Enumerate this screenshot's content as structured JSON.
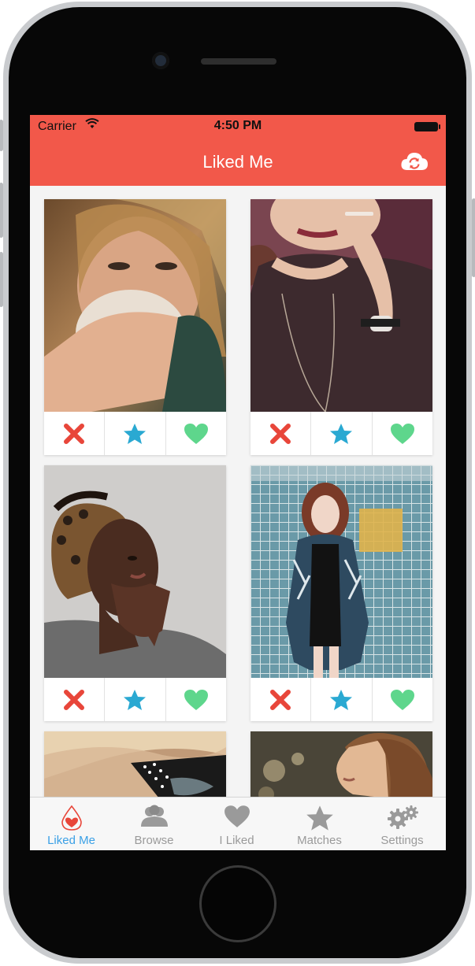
{
  "status": {
    "carrier": "Carrier",
    "time": "4:50 PM"
  },
  "navbar": {
    "title": "Liked Me",
    "sync_icon": "cloud-sync-icon"
  },
  "colors": {
    "brand": "#f2584a",
    "reject": "#e8463a",
    "star": "#2aa9d2",
    "like": "#5ed68c",
    "tab_active": "#3aa0e6",
    "tab_inactive": "#9a9a9a"
  },
  "cards": [
    {
      "photo": "woman-drinking-coffee"
    },
    {
      "photo": "woman-smoking-cigarette"
    },
    {
      "photo": "woman-looking-up"
    },
    {
      "photo": "woman-in-front-of-grid-wall"
    },
    {
      "photo": "woman-with-polka-dot-glasses"
    },
    {
      "photo": "woman-profile-bokeh"
    }
  ],
  "card_actions": [
    "reject-icon",
    "star-icon",
    "heart-icon"
  ],
  "tabs": [
    {
      "label": "Liked Me",
      "icon": "drop-heart-icon",
      "active": true
    },
    {
      "label": "Browse",
      "icon": "people-icon",
      "active": false
    },
    {
      "label": "I Liked",
      "icon": "heart-icon",
      "active": false
    },
    {
      "label": "Matches",
      "icon": "star-icon",
      "active": false
    },
    {
      "label": "Settings",
      "icon": "gears-icon",
      "active": false
    }
  ]
}
